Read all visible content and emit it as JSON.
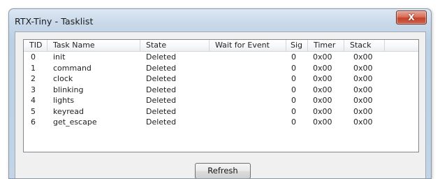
{
  "window": {
    "title": "RTX-Tiny - Tasklist",
    "close_glyph": "X"
  },
  "tasklist": {
    "columns": [
      "TID",
      "Task Name",
      "State",
      "Wait for Event",
      "Sig",
      "Timer",
      "Stack"
    ],
    "rows": [
      {
        "tid": "0",
        "name": "init",
        "state": "Deleted",
        "wait": "",
        "sig": "0",
        "timer": "0x00",
        "stack": "0x00"
      },
      {
        "tid": "1",
        "name": "command",
        "state": "Deleted",
        "wait": "",
        "sig": "0",
        "timer": "0x00",
        "stack": "0x00"
      },
      {
        "tid": "2",
        "name": "clock",
        "state": "Deleted",
        "wait": "",
        "sig": "0",
        "timer": "0x00",
        "stack": "0x00"
      },
      {
        "tid": "3",
        "name": "blinking",
        "state": "Deleted",
        "wait": "",
        "sig": "0",
        "timer": "0x00",
        "stack": "0x00"
      },
      {
        "tid": "4",
        "name": "lights",
        "state": "Deleted",
        "wait": "",
        "sig": "0",
        "timer": "0x00",
        "stack": "0x00"
      },
      {
        "tid": "5",
        "name": "keyread",
        "state": "Deleted",
        "wait": "",
        "sig": "0",
        "timer": "0x00",
        "stack": "0x00"
      },
      {
        "tid": "6",
        "name": "get_escape",
        "state": "Deleted",
        "wait": "",
        "sig": "0",
        "timer": "0x00",
        "stack": "0x00"
      }
    ]
  },
  "buttons": {
    "refresh_label": "Refresh"
  },
  "colors": {
    "title_bar": "#c9d9ea",
    "close_button": "#c4432c",
    "list_background": "#ffffff"
  },
  "icons": {
    "close": "close-icon"
  }
}
